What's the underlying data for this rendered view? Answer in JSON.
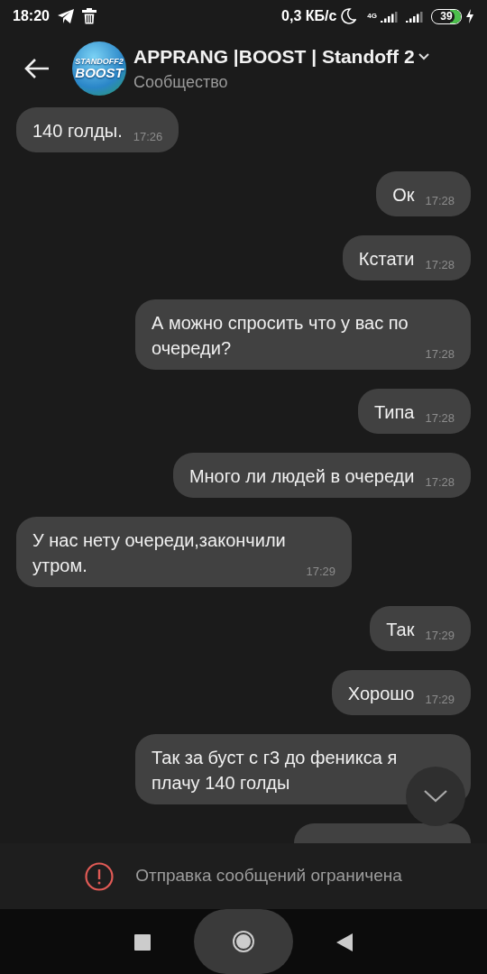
{
  "status_bar": {
    "time": "18:20",
    "speed": "0,3 КБ/с",
    "network": "4G",
    "battery": "39"
  },
  "header": {
    "title": "APPRANG |BOOST | Standoff 2",
    "subtitle": "Сообщество",
    "avatar_text": [
      "STANDOFF2",
      "BOOST"
    ]
  },
  "messages": [
    {
      "kind": "incoming",
      "text": "140 голды.",
      "time": "17:26"
    },
    {
      "kind": "outgoing",
      "text": "Ок",
      "time": "17:28"
    },
    {
      "kind": "outgoing",
      "text": "Кстати",
      "time": "17:28"
    },
    {
      "kind": "outgoing",
      "text": "А можно спросить что у вас по очереди?",
      "time": "17:28"
    },
    {
      "kind": "outgoing",
      "text": "Типа",
      "time": "17:28"
    },
    {
      "kind": "outgoing",
      "text": "Много ли людей в очереди",
      "time": "17:28"
    },
    {
      "kind": "incoming",
      "text": "У нас нету очереди,закончили утром.",
      "time": "17:29"
    },
    {
      "kind": "outgoing",
      "text": "Так",
      "time": "17:29"
    },
    {
      "kind": "outgoing",
      "text": "Хорошо",
      "time": "17:29"
    },
    {
      "kind": "outgoing",
      "text": "Так за буст с г3 до феникса я плачу 140 голды"
    },
    {
      "kind": "stub"
    }
  ],
  "notice": {
    "text": "Отправка сообщений ограничена"
  }
}
